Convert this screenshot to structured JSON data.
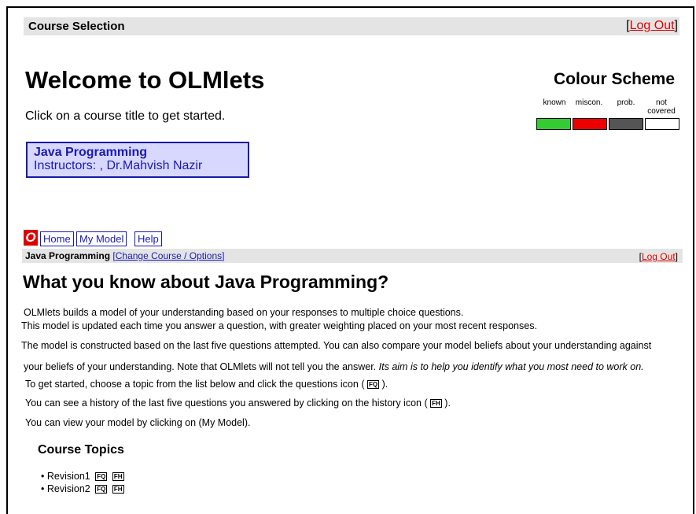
{
  "header": {
    "title": "Course Selection",
    "logout_label": "Log Out"
  },
  "welcome": {
    "heading": "Welcome to OLMlets",
    "instruction": "Click on a course title to get started."
  },
  "course_card": {
    "title": "Java Programming",
    "instructors": "Instructors: , Dr.Mahvish Nazir"
  },
  "colour_scheme": {
    "title": "Colour Scheme",
    "items": [
      {
        "label": "known",
        "color": "#33cc33"
      },
      {
        "label": "miscon.",
        "color": "#ee0000"
      },
      {
        "label": "prob.",
        "color": "#555555"
      },
      {
        "label": "not covered",
        "color": "#ffffff"
      }
    ]
  },
  "nav": {
    "logo": "O",
    "home": "Home",
    "my_model": "My Model",
    "help": "Help"
  },
  "course_bar": {
    "course": "Java Programming",
    "change_label": "Change Course / Options",
    "logout_label": "Log Out"
  },
  "main": {
    "heading": "What you know about Java Programming?",
    "p1": "OLMlets builds a model of your understanding based on your responses to multiple choice questions.",
    "p2": "This model is updated each time you answer a question, with greater weighting placed on your most recent  responses.",
    "p3": "The model is constructed based on the last five questions attempted.  You can also compare your model beliefs about your understanding against",
    "p4a": "your beliefs of your understanding. Note that OLMlets will not tell  you the answer.",
    "p4b": "Its aim is to help you identify what you most need to work on.",
    "p5a": "To get started, choose a topic from the list below and click the questions icon (",
    "p5b": ").",
    "p6a": "You can see a history of the last five questions you  answered by clicking on the history icon (",
    "p6b": ").",
    "p7": "You can view your model by clicking on (My Model).",
    "q_icon": "FQ",
    "h_icon": "FH"
  },
  "topics": {
    "title": "Course Topics",
    "items": [
      {
        "name": "Revision1",
        "q": "FQ",
        "h": "FH"
      },
      {
        "name": "Revision2",
        "q": "FQ",
        "h": "FH"
      }
    ]
  }
}
